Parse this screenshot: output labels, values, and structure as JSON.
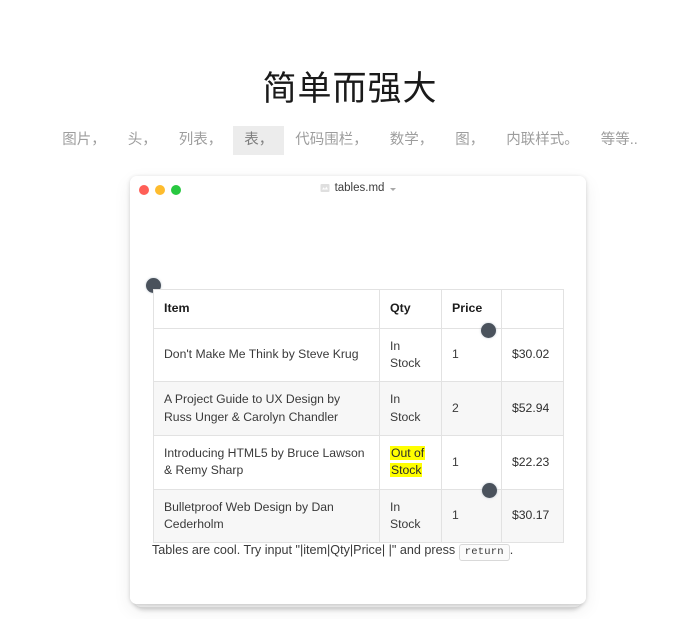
{
  "hero": {
    "title": "简单而强大"
  },
  "tabs": {
    "items": [
      {
        "label": "图片，",
        "active": false
      },
      {
        "label": "头，",
        "active": false
      },
      {
        "label": "列表，",
        "active": false
      },
      {
        "label": "表，",
        "active": true
      },
      {
        "label": "代码围栏，",
        "active": false
      },
      {
        "label": "数学，",
        "active": false
      },
      {
        "label": "图，",
        "active": false
      },
      {
        "label": "内联样式。",
        "active": false
      },
      {
        "label": "等等..",
        "active": false
      }
    ]
  },
  "window": {
    "filename": "tables.md",
    "traffic_lights": {
      "close_color": "#ff5f57",
      "minimize_color": "#febc2e",
      "zoom_color": "#28c840"
    }
  },
  "table": {
    "headers": [
      "Item",
      "Qty",
      "Price",
      ""
    ],
    "rows": [
      {
        "item": "Don't Make Me Think by Steve Krug",
        "qty": "In Stock",
        "qty_highlighted": false,
        "count": "1",
        "price": "$30.02",
        "extra": ""
      },
      {
        "item": "A Project Guide to UX Design by Russ Unger & Carolyn Chandler",
        "qty": "In Stock",
        "qty_highlighted": false,
        "count": "2",
        "price": "$52.94",
        "extra": ""
      },
      {
        "item": "Introducing HTML5 by Bruce Lawson & Remy Sharp",
        "qty": "Out of Stock",
        "qty_highlighted": true,
        "count": "1",
        "price": "$22.23",
        "extra": ""
      },
      {
        "item": "Bulletproof Web Design by Dan Cederholm",
        "qty": "In Stock",
        "qty_highlighted": false,
        "count": "1",
        "price": "$30.17",
        "extra": ""
      }
    ]
  },
  "footer": {
    "text_before": "Tables are cool. Try input \"|item|Qty|Price|  |\" and press ",
    "kbd": "return",
    "text_after": "."
  },
  "colors": {
    "highlight": "#ffff00",
    "cursor_blob": "#4a525c",
    "active_tab_bg": "#ececec",
    "table_border": "#e2e2e2",
    "row_alt_bg": "#f7f7f7"
  }
}
